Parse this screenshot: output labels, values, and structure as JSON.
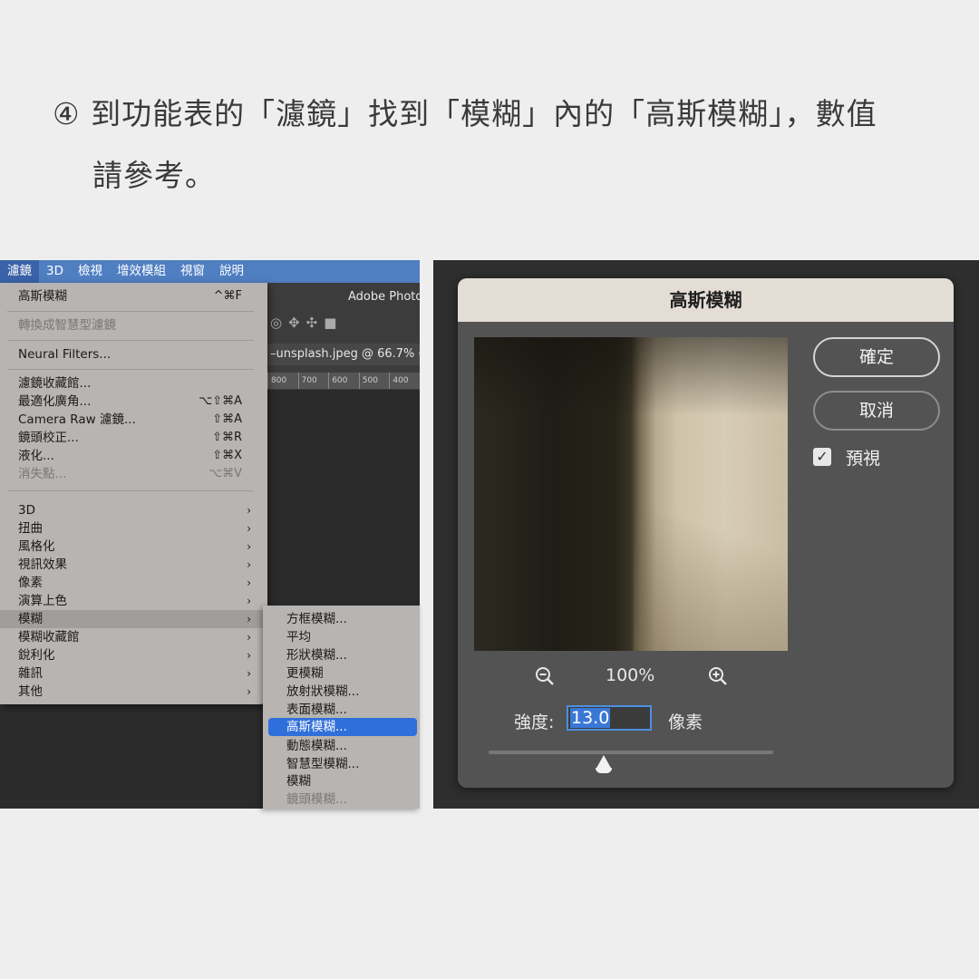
{
  "instruction": {
    "step_line1": "④ 到功能表的「濾鏡」找到「模糊」內的「高斯模糊」，數值",
    "step_line2": "請參考。"
  },
  "menubar": [
    "濾鏡",
    "3D",
    "檢視",
    "增效模組",
    "視窗",
    "說明"
  ],
  "photoshop": {
    "app_title": "Adobe Photo",
    "doc_tab": "–unsplash.jpeg @ 66.7% (",
    "ruler_ticks": [
      "800",
      "700",
      "600",
      "500",
      "400"
    ]
  },
  "filter_menu": {
    "items": [
      {
        "label": "高斯模糊",
        "shortcut": "^⌘F"
      },
      {
        "label": "轉換成智慧型濾鏡"
      },
      {
        "label": "Neural Filters..."
      },
      {
        "label": "濾鏡收藏館..."
      },
      {
        "label": "最適化廣角...",
        "shortcut": "⌥⇧⌘A"
      },
      {
        "label": "Camera Raw 濾鏡...",
        "shortcut": "⇧⌘A"
      },
      {
        "label": "鏡頭校正...",
        "shortcut": "⇧⌘R"
      },
      {
        "label": "液化...",
        "shortcut": "⇧⌘X"
      },
      {
        "label": "消失點...",
        "shortcut": "⌥⌘V"
      },
      {
        "label": "3D"
      },
      {
        "label": "扭曲"
      },
      {
        "label": "風格化"
      },
      {
        "label": "視訊效果"
      },
      {
        "label": "像素"
      },
      {
        "label": "演算上色"
      },
      {
        "label": "模糊"
      },
      {
        "label": "模糊收藏館"
      },
      {
        "label": "銳利化"
      },
      {
        "label": "雜訊"
      },
      {
        "label": "其他"
      }
    ],
    "submenu_arrow": "›"
  },
  "blur_submenu": [
    "方框模糊...",
    "平均",
    "形狀模糊...",
    "更模糊",
    "放射狀模糊...",
    "表面模糊...",
    "高斯模糊...",
    "動態模糊...",
    "智慧型模糊...",
    "模糊",
    "鏡頭模糊..."
  ],
  "dialog": {
    "title": "高斯模糊",
    "ok_label": "確定",
    "cancel_label": "取消",
    "preview_label": "預視",
    "preview_checked": true,
    "zoom_level": "100%",
    "radius_label": "強度:",
    "radius_value": "13.0",
    "radius_unit": "像素"
  },
  "colors": {
    "menubar": "#4f7ec1",
    "menu_bg": "#b7b4b1",
    "selection": "#2f6fdb",
    "dialog_bg": "#535353",
    "dialog_title_bg": "#e3ddd6"
  }
}
